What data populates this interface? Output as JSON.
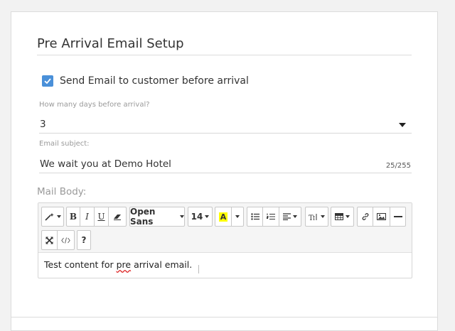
{
  "section": {
    "title": "Pre Arrival Email Setup"
  },
  "send_email": {
    "label": "Send Email to customer before arrival",
    "checked": true
  },
  "days_field": {
    "label": "How many days before arrival?",
    "value": "3"
  },
  "subject_field": {
    "label": "Email subject:",
    "value": "We wait you at Demo Hotel",
    "counter": "25/255"
  },
  "mail_body": {
    "label": "Mail Body:",
    "toolbar": {
      "font_name": "Open Sans",
      "font_size": "14",
      "font_color_letter": "A",
      "help": "?",
      "icons": [
        "magic-icon",
        "bold-icon",
        "italic-icon",
        "underline-icon",
        "eraser-icon",
        "font-name-dropdown",
        "font-size-dropdown",
        "font-color-icon",
        "color-dropdown",
        "unordered-list-icon",
        "ordered-list-icon",
        "paragraph-align-icon",
        "line-height-icon",
        "table-icon",
        "link-icon",
        "picture-icon",
        "horizontal-rule-icon",
        "fullscreen-icon",
        "code-view-icon",
        "help-icon"
      ]
    },
    "content_before": "Test content for ",
    "content_misspelled": "pre",
    "content_after": " arrival email."
  },
  "colors": {
    "checkbox": "#4a90d9",
    "font_color_highlight": "#ffff00"
  }
}
